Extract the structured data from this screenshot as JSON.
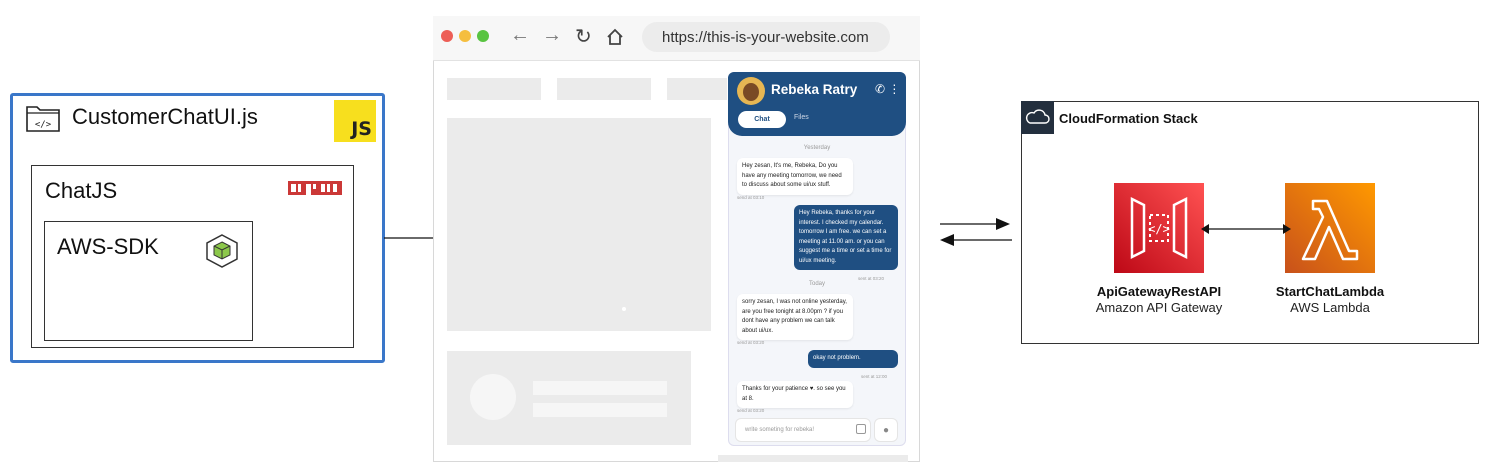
{
  "left_stack": {
    "file_title": "CustomerChatUI.js",
    "js_badge": "JS",
    "chatjs_label": "ChatJS",
    "npm_logo": "npm",
    "sdk_label": "AWS-SDK"
  },
  "browser": {
    "url": "https://this-is-your-website.com",
    "icons": [
      "back-arrow-icon",
      "forward-arrow-icon",
      "reload-icon",
      "home-icon"
    ]
  },
  "chat_widget": {
    "agent_name": "Rebeka Ratry",
    "tab_chat": "Chat",
    "tab_files": "Files",
    "day_yesterday": "Yesterday",
    "day_today": "Today",
    "messages": [
      {
        "dir": "in",
        "text": "Hey zesan, It's me, Rebeka, Do you have any meeting tomorrow, we need to discuss about some ui/ux stuff.",
        "meta": "send at 03:10"
      },
      {
        "dir": "out",
        "text": "Hey Rebeka, thanks for your interest. I checked my calendar. tomorrow I am free. we can set a meeting at 11.00 am. or you can suggest me a time or set a time for ui/ux meeting.",
        "meta": "sent at 03:20"
      },
      {
        "dir": "in",
        "text": "sorry zesan, I was not online yesterday, are you free tonight at 8.00pm ? if you dont have any problem we can talk about ui/ux.",
        "meta": "send at 03:20"
      },
      {
        "dir": "out",
        "text": "okay not problem.",
        "meta": "sent at 12:00"
      },
      {
        "dir": "in",
        "text": "Thanks for your patience ♥. so see you at 8.",
        "meta": "send at 03:20"
      }
    ],
    "composer_placeholder": "write someting for rebeka!"
  },
  "cloudformation": {
    "title": "CloudFormation Stack",
    "services": [
      {
        "name": "ApiGatewayRestAPI",
        "type": "Amazon API Gateway"
      },
      {
        "name": "StartChatLambda",
        "type": "AWS Lambda"
      }
    ]
  }
}
